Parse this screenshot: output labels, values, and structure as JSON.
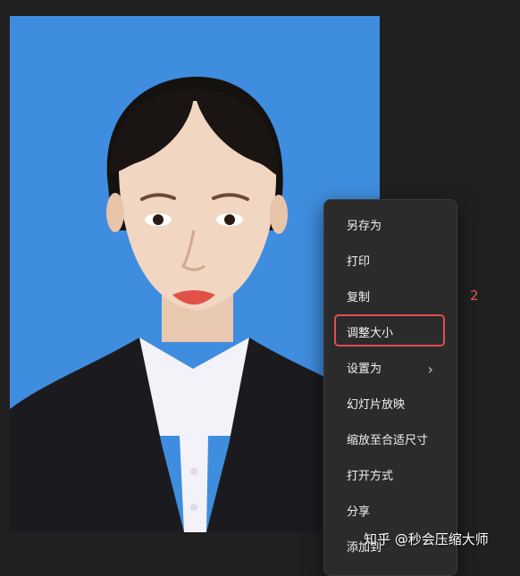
{
  "photo": {
    "background_color": "#3f8ddf",
    "subject": "portrait-photo"
  },
  "context_menu": {
    "items": [
      {
        "label": "另存为",
        "has_submenu": false
      },
      {
        "label": "打印",
        "has_submenu": false
      },
      {
        "label": "复制",
        "has_submenu": false
      },
      {
        "label": "调整大小",
        "has_submenu": false,
        "highlighted": true
      },
      {
        "label": "设置为",
        "has_submenu": true
      },
      {
        "label": "幻灯片放映",
        "has_submenu": false
      },
      {
        "label": "缩放至合适尺寸",
        "has_submenu": false
      },
      {
        "label": "打开方式",
        "has_submenu": false
      },
      {
        "label": "分享",
        "has_submenu": false
      },
      {
        "label": "添加到",
        "has_submenu": false
      }
    ],
    "submenu_icon": "chevron-right-icon"
  },
  "annotation": {
    "step_number": "2",
    "highlight_color": "#e34d4d"
  },
  "watermark": {
    "text": "知乎 @秒会压缩大师"
  }
}
